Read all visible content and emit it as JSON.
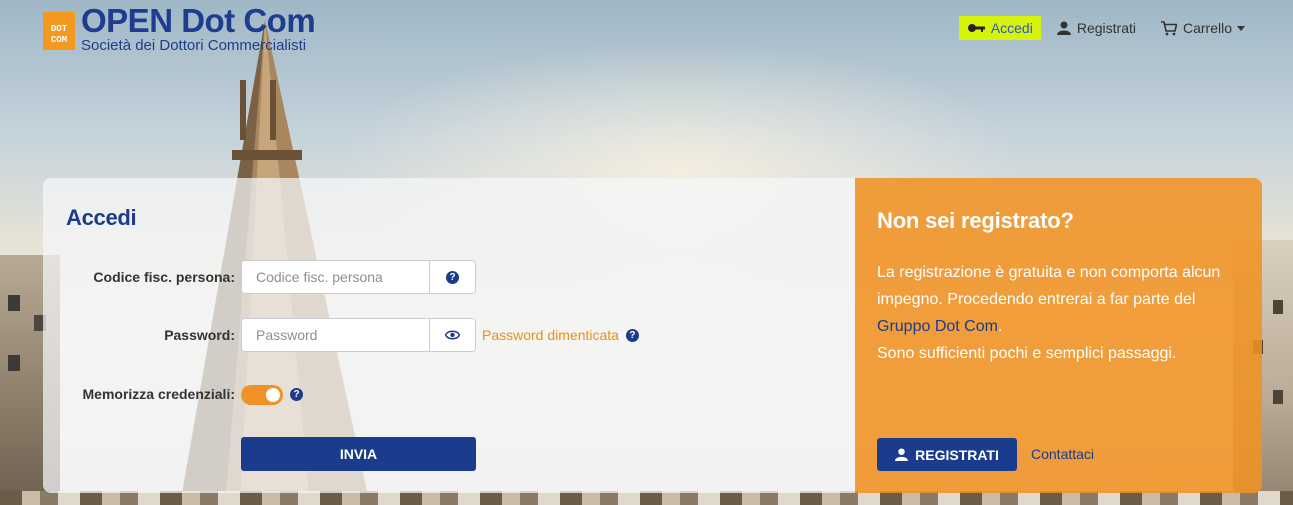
{
  "header": {
    "logo_mark_top": "DOT",
    "logo_mark_bottom": "COM",
    "logo_title": "OPEN Dot Com",
    "logo_subtitle": "Società dei Dottori Commercialisti",
    "nav": {
      "login": "Accedi",
      "register": "Registrati",
      "cart": "Carrello"
    },
    "active_color": "#d6f30a"
  },
  "login": {
    "title": "Accedi",
    "fiscal_code_label": "Codice fisc. persona:",
    "fiscal_code_placeholder": "Codice fisc. persona",
    "password_label": "Password:",
    "password_placeholder": "Password",
    "forgot_password": "Password dimenticata",
    "remember_label": "Memorizza credenziali:",
    "remember_enabled": true,
    "submit": "INVIA"
  },
  "register_panel": {
    "title": "Non sei registrato?",
    "text_part1": "La registrazione è gratuita e non comporta alcun impegno. Procedendo entrerai a far parte del ",
    "group_link": "Gruppo Dot Com",
    "text_part2": ".",
    "text_line2": "Sono sufficienti pochi e semplici passaggi.",
    "register_button": "REGISTRATI",
    "contact_link": "Contattaci"
  },
  "colors": {
    "brand_blue": "#1b3c8c",
    "accent_orange": "#f0922a",
    "orange_panel": "#f09224"
  }
}
